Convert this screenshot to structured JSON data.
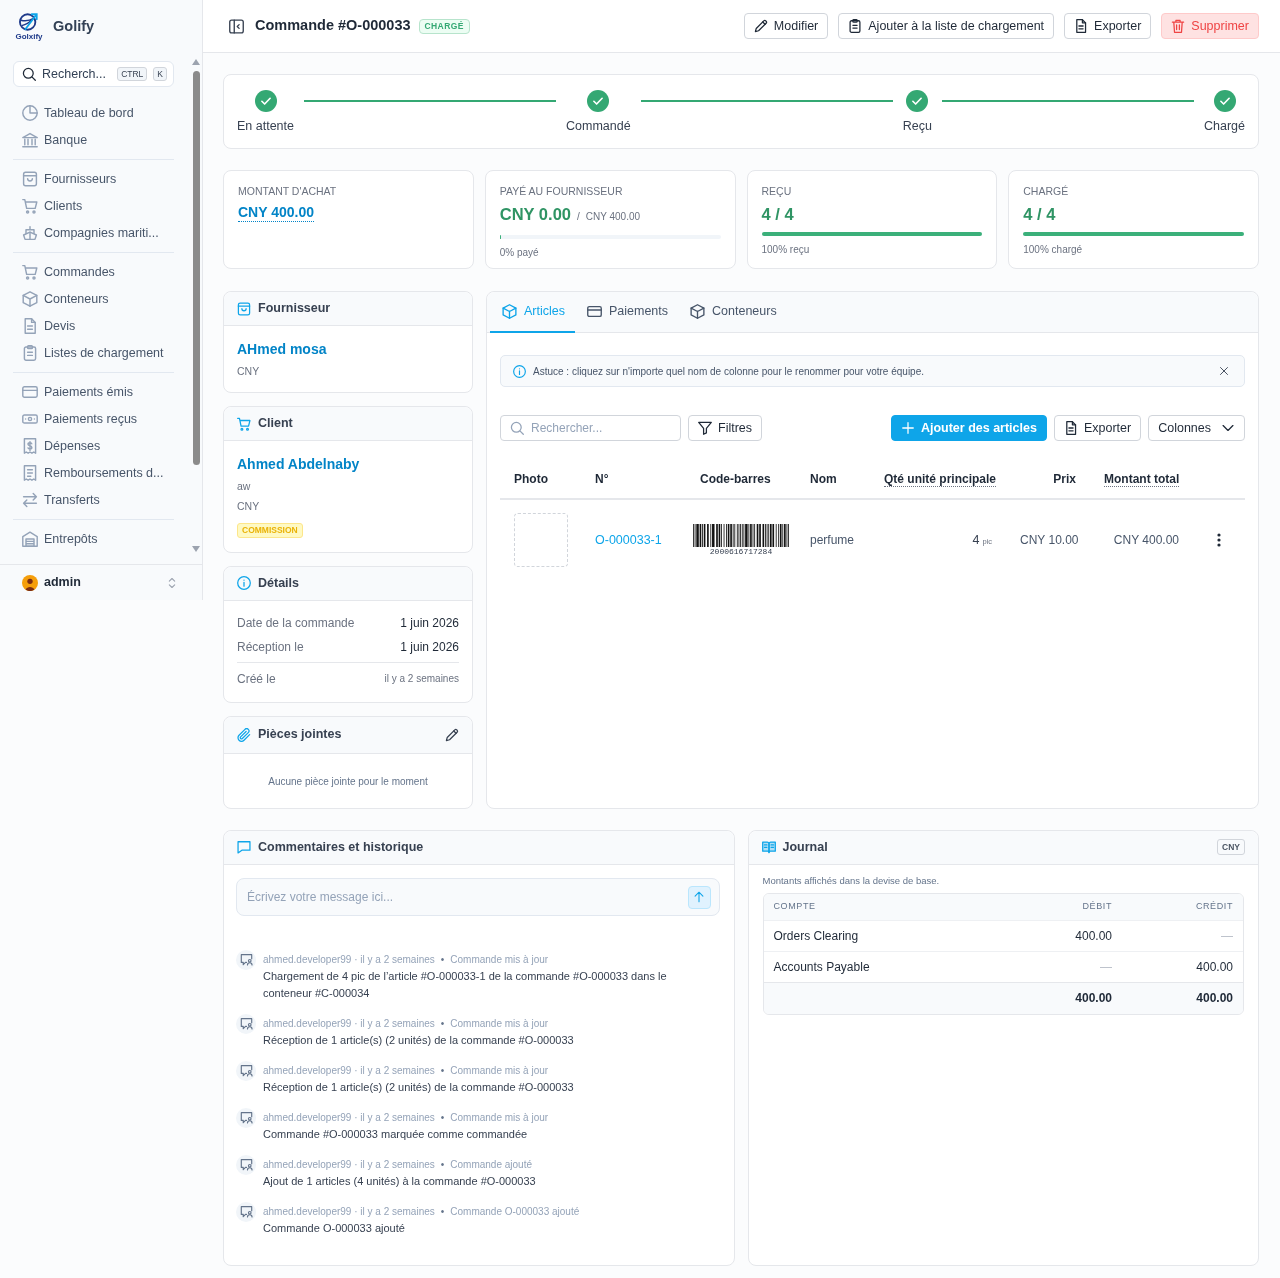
{
  "sidebar": {
    "logo_text": "Golxify",
    "brand": "Golify",
    "search": {
      "label": "Recherch...",
      "keys": [
        "CTRL",
        "K"
      ]
    },
    "groups": [
      [
        {
          "label": "Tableau de bord",
          "selected": false
        },
        {
          "label": "Banque",
          "selected": false
        }
      ],
      [
        {
          "label": "Fournisseurs",
          "selected": false
        },
        {
          "label": "Clients",
          "selected": false
        },
        {
          "label": "Compagnies mariti...",
          "selected": false
        }
      ],
      [
        {
          "label": "Commandes",
          "selected": false
        },
        {
          "label": "Conteneurs",
          "selected": false
        },
        {
          "label": "Devis",
          "selected": false
        },
        {
          "label": "Listes de chargement",
          "selected": false
        }
      ],
      [
        {
          "label": "Paiements émis",
          "selected": false
        },
        {
          "label": "Paiements reçus",
          "selected": false
        },
        {
          "label": "Dépenses",
          "selected": false
        },
        {
          "label": "Remboursements d...",
          "selected": false
        },
        {
          "label": "Transferts",
          "selected": false
        }
      ],
      [
        {
          "label": "Entrepôts",
          "selected": false
        }
      ]
    ],
    "user": {
      "name": "admin"
    }
  },
  "header": {
    "title": "Commande #O-000033",
    "status": "CHARGÉ",
    "actions": [
      {
        "kind": "outline",
        "label": "Modifier"
      },
      {
        "kind": "outline",
        "label": "Ajouter à la liste de chargement"
      },
      {
        "kind": "outline",
        "label": "Exporter"
      },
      {
        "kind": "danger",
        "label": "Supprimer"
      }
    ]
  },
  "steps": [
    {
      "label": "En attente",
      "done": true
    },
    {
      "label": "Commandé",
      "done": true
    },
    {
      "label": "Reçu",
      "done": true
    },
    {
      "label": "Chargé",
      "done": true
    }
  ],
  "stats": [
    {
      "kind": "amount",
      "label": "MONTANT D'ACHAT",
      "value": "CNY 400.00"
    },
    {
      "kind": "progress",
      "label": "PAYÉ AU FOURNISSEUR",
      "value": "CNY 0.00",
      "separator": "/",
      "total": "CNY 400.00",
      "level": 0,
      "caption": "0% payé"
    },
    {
      "kind": "progress",
      "label": "REÇU",
      "value": "4 / 4",
      "level": 1,
      "caption": "100% reçu"
    },
    {
      "kind": "progress",
      "label": "CHARGÉ",
      "value": "4 / 4",
      "level": 1,
      "caption": "100% chargé"
    }
  ],
  "supplier": {
    "title": "Fournisseur",
    "name": "AHmed mosa",
    "lines": [
      "CNY"
    ]
  },
  "client": {
    "title": "Client",
    "name": "Ahmed Abdelnaby",
    "lines": [
      "aw",
      "CNY"
    ],
    "tag": "COMMISSION"
  },
  "details": {
    "title": "Détails",
    "rows": [
      {
        "kind": "date",
        "label": "Date de la commande",
        "value": "1 juin 2026"
      },
      {
        "kind": "date",
        "label": "Réception le",
        "value": "1 juin 2026"
      },
      {
        "kind": "relative",
        "label": "Créé le",
        "value": "il y a 2 semaines"
      }
    ]
  },
  "attachments": {
    "title": "Pièces jointes",
    "empty": "Aucune pièce jointe pour le moment"
  },
  "items_panel": {
    "tabs": [
      {
        "label": "Articles",
        "selected": true
      },
      {
        "label": "Paiements",
        "selected": false
      },
      {
        "label": "Conteneurs",
        "selected": false
      }
    ],
    "tip": "Astuce : cliquez sur n'importe quel nom de colonne pour le renommer pour votre équipe.",
    "search": {
      "placeholder": "Rechercher..."
    },
    "filter": {
      "label": "Filtres"
    },
    "actions": [
      {
        "kind": "primary",
        "label": "Ajouter des articles"
      },
      {
        "kind": "outline",
        "label": "Exporter"
      },
      {
        "kind": "dropdown",
        "label": "Colonnes"
      }
    ],
    "columns": [
      {
        "label": "Photo",
        "underlined": false
      },
      {
        "label": "N°",
        "underlined": false
      },
      {
        "label": "Code-barres",
        "underlined": false
      },
      {
        "label": "Nom",
        "underlined": false
      },
      {
        "label": "Qté unité principale",
        "underlined": true
      },
      {
        "label": "Prix",
        "underlined": false
      },
      {
        "label": "Montant total",
        "underlined": true
      }
    ],
    "rows": [
      {
        "number": "O-000033-1",
        "barcode": "2000616717284",
        "name": "perfume",
        "qty": "4",
        "unit": "pic",
        "price": "CNY 10.00",
        "total": "CNY 400.00"
      }
    ]
  },
  "comments": {
    "title": "Commentaires et historique",
    "placeholder": "Écrivez votre message ici...",
    "entries": [
      {
        "meta": "ahmed.developer99 · il y a 2 semaines",
        "separator": "•",
        "action": "Commande mis à jour",
        "text": "Chargement de 4 pic de l’article #O-000033-1 de la commande #O-000033 dans le conteneur #C-000034"
      },
      {
        "meta": "ahmed.developer99 · il y a 2 semaines",
        "separator": "•",
        "action": "Commande mis à jour",
        "text": "Réception de 1 article(s) (2 unités) de la commande #O-000033"
      },
      {
        "meta": "ahmed.developer99 · il y a 2 semaines",
        "separator": "•",
        "action": "Commande mis à jour",
        "text": "Réception de 1 article(s) (2 unités) de la commande #O-000033"
      },
      {
        "meta": "ahmed.developer99 · il y a 2 semaines",
        "separator": "•",
        "action": "Commande mis à jour",
        "text": "Commande #O-000033 marquée comme commandée"
      },
      {
        "meta": "ahmed.developer99 · il y a 2 semaines",
        "separator": "•",
        "action": "Commande ajouté",
        "text": "Ajout de 1 articles (4 unités) à la commande #O-000033"
      },
      {
        "meta": "ahmed.developer99 · il y a 2 semaines",
        "separator": "•",
        "action": "Commande O-000033 ajouté",
        "text": "Commande O-000033 ajouté"
      }
    ]
  },
  "journal": {
    "title": "Journal",
    "currency": "CNY",
    "note": "Montants affichés dans la devise de base.",
    "columns": [
      "COMPTE",
      "DÉBIT",
      "CRÉDIT"
    ],
    "rows": [
      {
        "account": "Orders Clearing",
        "debit": {
          "text": "400.00",
          "muted": false
        },
        "credit": {
          "text": "—",
          "muted": true
        }
      },
      {
        "account": "Accounts Payable",
        "debit": {
          "text": "—",
          "muted": true
        },
        "credit": {
          "text": "400.00",
          "muted": false
        }
      }
    ],
    "totals": {
      "debit": "400.00",
      "credit": "400.00"
    }
  }
}
